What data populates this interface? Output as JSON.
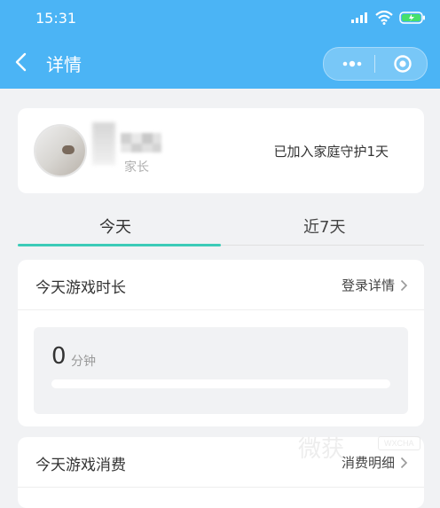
{
  "status_bar": {
    "time": "15:31"
  },
  "nav": {
    "title": "详情"
  },
  "profile": {
    "role": "家长",
    "guard_text": "已加入家庭守护1天"
  },
  "tabs": [
    {
      "label": "今天"
    },
    {
      "label": "近7天"
    }
  ],
  "game_time": {
    "title": "今天游戏时长",
    "link": "登录详情",
    "value": "0",
    "unit": "分钟",
    "progress_fraction": 0
  },
  "game_spend": {
    "title": "今天游戏消费",
    "link": "消费明细"
  },
  "watermark": {
    "cn": "微获",
    "en": "WXCHA"
  },
  "colors": {
    "header": "#4bb4f5",
    "accent": "#3ccbb8",
    "background": "#f1f2f4"
  },
  "icons": [
    "back-arrow-icon",
    "more-dots-icon",
    "close-circle-icon",
    "chevron-right-icon",
    "wifi-icon",
    "signal-icon",
    "battery-icon"
  ]
}
